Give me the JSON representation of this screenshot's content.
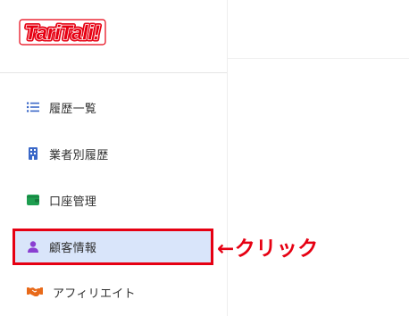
{
  "brand": {
    "logo_text": "TariTali!",
    "logo_color": "#e60012"
  },
  "sidebar": {
    "items": [
      {
        "label": "履歴一覧",
        "icon": "list-icon",
        "icon_color": "#3b68c8"
      },
      {
        "label": "業者別履歴",
        "icon": "building-icon",
        "icon_color": "#3b68c8"
      },
      {
        "label": "口座管理",
        "icon": "wallet-icon",
        "icon_color": "#1e9e50"
      },
      {
        "label": "顧客情報",
        "icon": "user-icon",
        "icon_color": "#8a3fd1",
        "active": true
      },
      {
        "label": "アフィリエイト",
        "icon": "handshake-icon",
        "icon_color": "#e86a1a"
      }
    ],
    "active_bg": "#d9e5fa"
  },
  "annotation": {
    "text": "←クリック",
    "color": "#e60012"
  }
}
